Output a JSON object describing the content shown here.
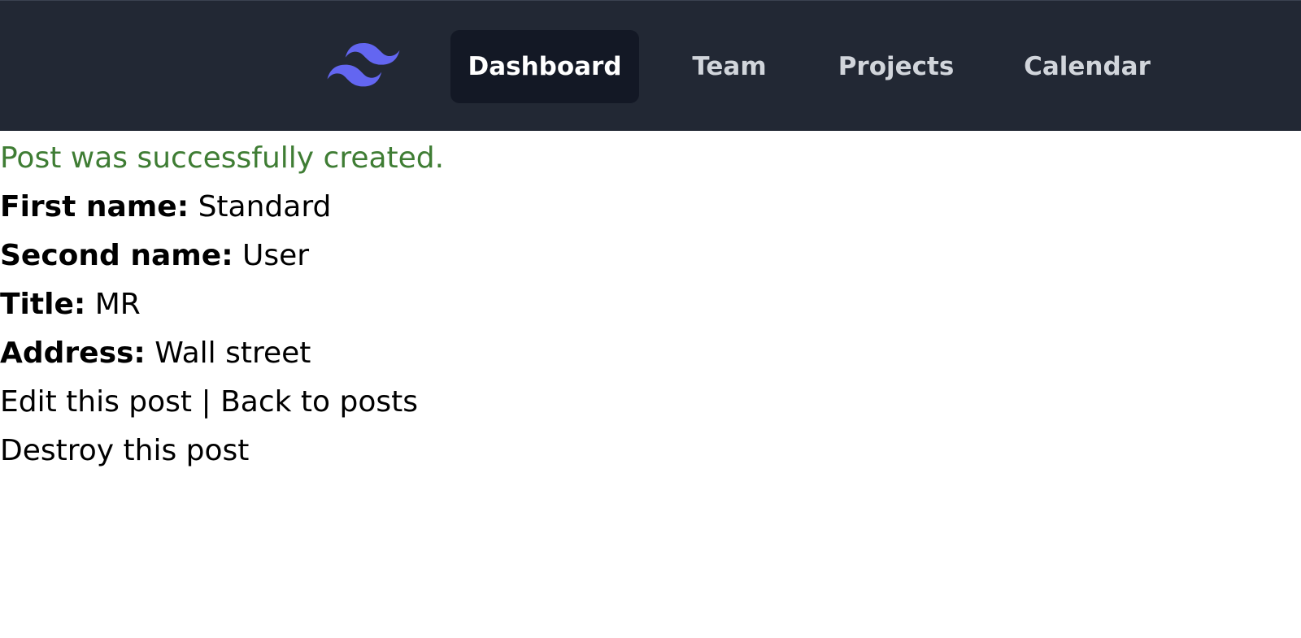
{
  "nav": {
    "logo_icon": "tailwind-logo-icon",
    "logo_color": "#6366f1",
    "items": [
      {
        "label": "Dashboard",
        "active": true
      },
      {
        "label": "Team",
        "active": false
      },
      {
        "label": "Projects",
        "active": false
      },
      {
        "label": "Calendar",
        "active": false
      }
    ]
  },
  "notice": "Post was successfully created.",
  "fields": {
    "first_name": {
      "label": "First name:",
      "value": "Standard"
    },
    "second_name": {
      "label": "Second name:",
      "value": "User"
    },
    "title": {
      "label": "Title:",
      "value": "MR"
    },
    "address": {
      "label": "Address:",
      "value": "Wall street"
    }
  },
  "links": {
    "edit": "Edit this post",
    "separator": "|",
    "back": "Back to posts",
    "destroy": "Destroy this post"
  },
  "colors": {
    "navbar_bg": "#222834",
    "active_bg": "#131825",
    "notice_text": "#3f7d34"
  }
}
